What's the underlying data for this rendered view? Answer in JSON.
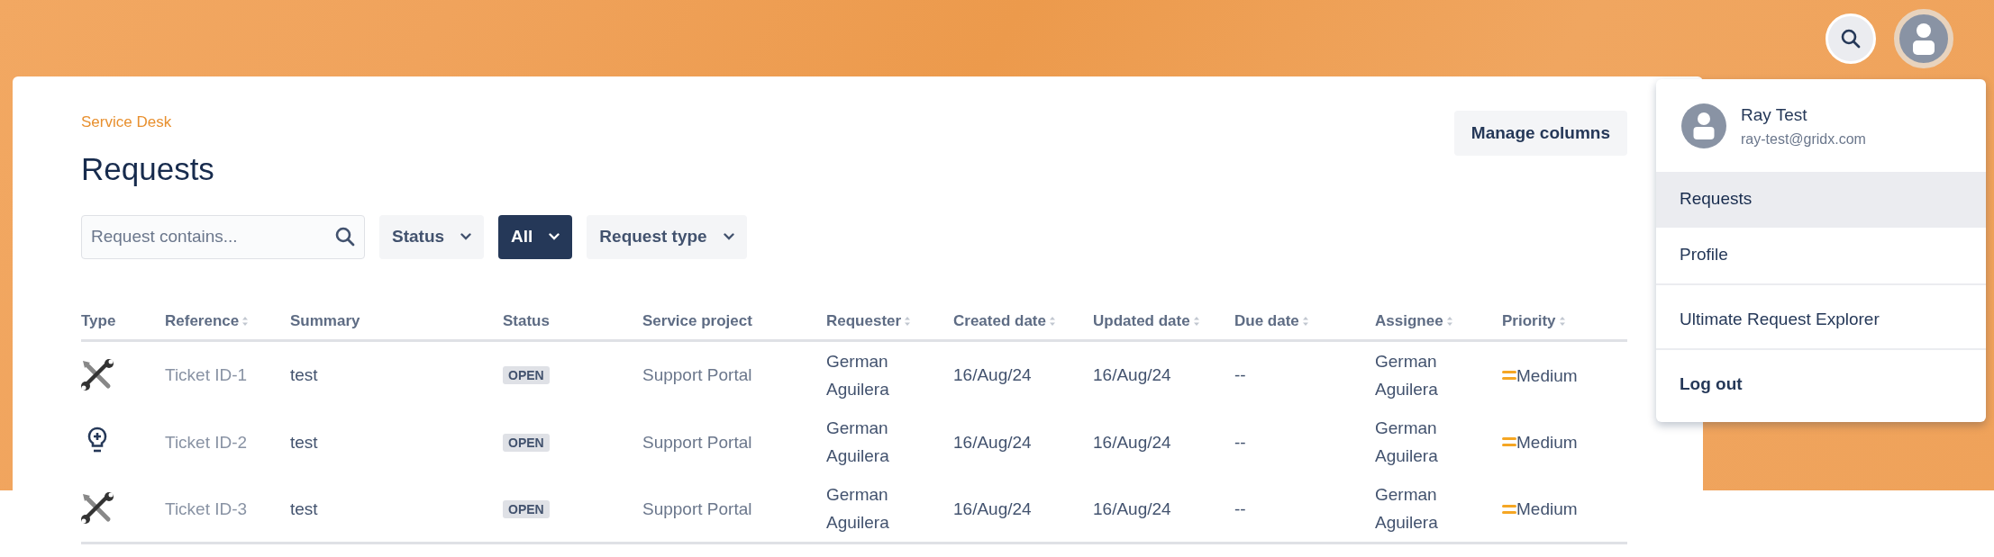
{
  "breadcrumb": "Service Desk",
  "title": "Requests",
  "manage_button": "Manage columns",
  "search": {
    "placeholder": "Request contains..."
  },
  "filters": [
    {
      "label": "Status",
      "selected": false
    },
    {
      "label": "All",
      "selected": true
    },
    {
      "label": "Request type",
      "selected": false
    }
  ],
  "table": {
    "columns": [
      {
        "label": "Type",
        "sortable": false
      },
      {
        "label": "Reference",
        "sortable": true
      },
      {
        "label": "Summary",
        "sortable": false
      },
      {
        "label": "Status",
        "sortable": false
      },
      {
        "label": "Service project",
        "sortable": false
      },
      {
        "label": "Requester",
        "sortable": true
      },
      {
        "label": "Created date",
        "sortable": true
      },
      {
        "label": "Updated date",
        "sortable": true
      },
      {
        "label": "Due date",
        "sortable": true
      },
      {
        "label": "Assignee",
        "sortable": true
      },
      {
        "label": "Priority",
        "sortable": true
      }
    ],
    "rows": [
      {
        "kind": "wrench",
        "reference": "Ticket ID-1",
        "summary": "test",
        "status": "OPEN",
        "project": "Support Portal",
        "requester": "German Aguilera",
        "created": "16/Aug/24",
        "updated": "16/Aug/24",
        "due": "--",
        "assignee": "German Aguilera",
        "priority": "Medium"
      },
      {
        "kind": "bulb",
        "reference": "Ticket ID-2",
        "summary": "test",
        "status": "OPEN",
        "project": "Support Portal",
        "requester": "German Aguilera",
        "created": "16/Aug/24",
        "updated": "16/Aug/24",
        "due": "--",
        "assignee": "German Aguilera",
        "priority": "Medium"
      },
      {
        "kind": "wrench",
        "reference": "Ticket ID-3",
        "summary": "test",
        "status": "OPEN",
        "project": "Support Portal",
        "requester": "German Aguilera",
        "created": "16/Aug/24",
        "updated": "16/Aug/24",
        "due": "--",
        "assignee": "German Aguilera",
        "priority": "Medium"
      }
    ]
  },
  "user_menu": {
    "name": "Ray Test",
    "email": "ray-test@gridx.com",
    "groups": [
      [
        {
          "label": "Requests",
          "selected": true,
          "kind": "link"
        },
        {
          "label": "Profile",
          "selected": false,
          "kind": "link"
        }
      ],
      [
        {
          "label": "Ultimate Request Explorer",
          "selected": false,
          "kind": "link"
        }
      ],
      [
        {
          "label": "Log out",
          "selected": false,
          "kind": "logout"
        }
      ]
    ]
  }
}
